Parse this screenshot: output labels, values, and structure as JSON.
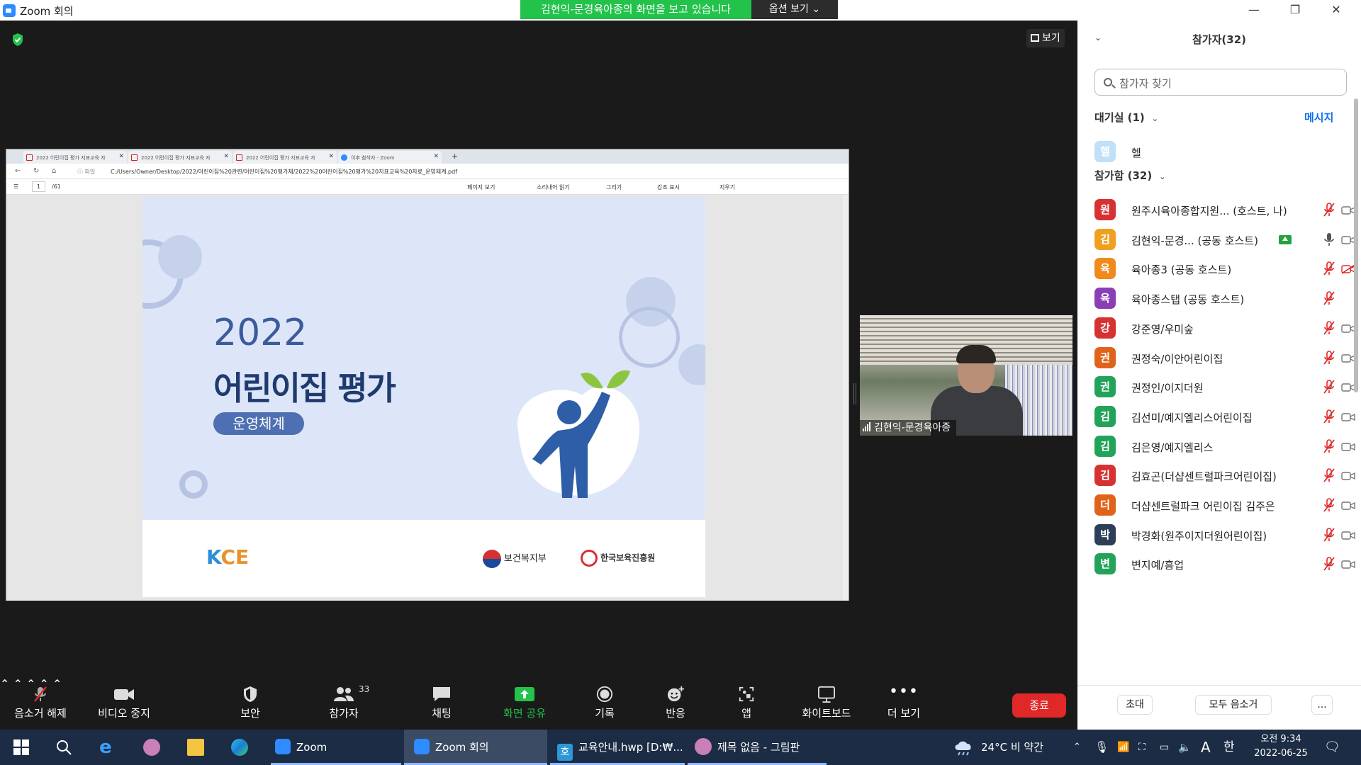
{
  "window": {
    "title": "Zoom 회의",
    "share_banner": "김현익-문경육아종의 화면을 보고 있습니다",
    "options_label": "옵션 보기 ⌄",
    "minimize": "—",
    "restore": "❐",
    "close": "✕"
  },
  "meeting": {
    "view_label": "보기",
    "video_tile_name": "김현익-문경육아종"
  },
  "shared_screen": {
    "tabs": [
      {
        "label": "2022 어린이집 평가 지표교육 자"
      },
      {
        "label": "2022 어린이집 평가 지표교육 자"
      },
      {
        "label": "2022 어린이집 평가 지표교육 자"
      },
      {
        "label": "이후 참석자 - Zoom"
      }
    ],
    "new_tab": "+",
    "file_label": "ⓘ 파일",
    "url": "C:/Users/Owner/Desktop/2022/어린이집%20관련/어린이집%20평가제/2022%20어린이집%20평가%20지표교육%20자료_운영체계.pdf",
    "pdf_toolbar": {
      "page": "1",
      "page_total": "/61",
      "page_view": "페이지 보기",
      "read_aloud": "소리내어 읽기",
      "draw": "그리기",
      "highlight": "강조 표시",
      "erase": "지우기"
    },
    "slide": {
      "year": "2022",
      "title": "어린이집 평가",
      "badge": "운영체계",
      "logo_kce_k": "K",
      "logo_kce_rest": "CE",
      "logo_mohw": "보건복지부",
      "logo_kcpi": "한국보육진흥원"
    }
  },
  "controls": {
    "mute": "음소거 해제",
    "video": "비디오 중지",
    "security": "보안",
    "participants": "참가자",
    "participants_count": "33",
    "chat": "채팅",
    "share": "화면 공유",
    "record": "기록",
    "reactions": "반응",
    "apps": "앱",
    "whiteboard": "화이트보드",
    "more": "더 보기",
    "end": "종료"
  },
  "panel": {
    "title": "참가자(32)",
    "search_placeholder": "참가자 찾기",
    "waiting_label": "대기실 (1)",
    "message_link": "메시지",
    "in_meeting_label": "참가함 (32)",
    "waiting": [
      {
        "initial": "헬",
        "name": "헬",
        "color": "#bfe0f7"
      }
    ],
    "participants": [
      {
        "initial": "원",
        "name": "원주시육아종합지원... (호스트, 나)",
        "color": "#d73232",
        "mic": "muted",
        "cam": "on"
      },
      {
        "initial": "김",
        "name": "김현익-문경...    (공동 호스트)",
        "color": "#f0a020",
        "mic": "on",
        "cam": "on",
        "sharing": true
      },
      {
        "initial": "육",
        "name": "육아종3 (공동 호스트)",
        "color": "#f08a1c",
        "mic": "muted",
        "cam": "off"
      },
      {
        "initial": "육",
        "name": "육아종스탭 (공동 호스트)",
        "color": "#8b3fb5",
        "mic": "muted",
        "cam": "none"
      },
      {
        "initial": "강",
        "name": "강준영/우미숲",
        "color": "#d73232",
        "mic": "muted",
        "cam": "on"
      },
      {
        "initial": "권",
        "name": "권정숙/이안어린이집",
        "color": "#e0631c",
        "mic": "muted",
        "cam": "on"
      },
      {
        "initial": "권",
        "name": "권정인/이지더원",
        "color": "#23a35a",
        "mic": "muted",
        "cam": "on"
      },
      {
        "initial": "김",
        "name": "김선미/예지엘리스어린이집",
        "color": "#23a35a",
        "mic": "muted",
        "cam": "on"
      },
      {
        "initial": "김",
        "name": "김은영/예지엘리스",
        "color": "#23a35a",
        "mic": "muted",
        "cam": "on"
      },
      {
        "initial": "김",
        "name": "김효곤(더샵센트럴파크어린이집)",
        "color": "#d73232",
        "mic": "muted",
        "cam": "on"
      },
      {
        "initial": "더",
        "name": "더샵센트럴파크 어린이집 김주은",
        "color": "#e0631c",
        "mic": "muted",
        "cam": "on"
      },
      {
        "initial": "박",
        "name": "박경화(원주이지더원어린이집)",
        "color": "#2c3e5a",
        "mic": "muted",
        "cam": "on"
      },
      {
        "initial": "변",
        "name": "변지예/흥업",
        "color": "#23a35a",
        "mic": "muted",
        "cam": "on"
      }
    ],
    "invite": "초대",
    "mute_all": "모두 음소거",
    "more": "..."
  },
  "taskbar": {
    "zoom_app": "Zoom",
    "zoom_meeting": "Zoom 회의",
    "hwp": "교육안내.hwp [D:₩...",
    "paint": "제목 없음 - 그림판",
    "weather": "24°C  비 약간",
    "ime_a": "A",
    "ime_han": "한",
    "time": "오전 9:34",
    "date": "2022-06-25"
  },
  "colors": {
    "accent": "#0e71eb",
    "share_green": "#23c24b",
    "end_red": "#e02828"
  }
}
